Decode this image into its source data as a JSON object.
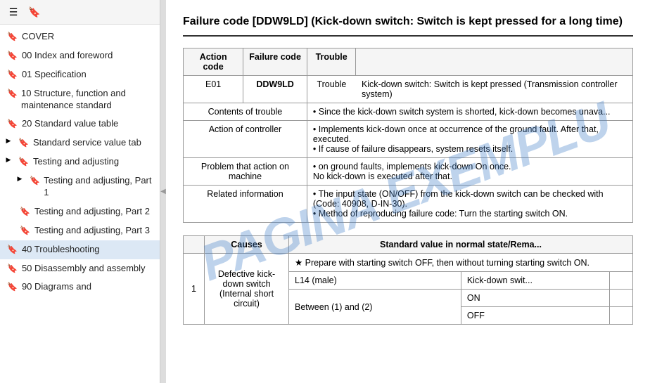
{
  "sidebar": {
    "toolbar": {
      "icon1": "☰",
      "icon2": "🔖"
    },
    "items": [
      {
        "id": "cover",
        "label": "COVER",
        "indent": 0,
        "has_arrow": false
      },
      {
        "id": "00-index",
        "label": "00 Index and foreword",
        "indent": 0,
        "has_arrow": false
      },
      {
        "id": "01-spec",
        "label": "01 Specification",
        "indent": 0,
        "has_arrow": false
      },
      {
        "id": "10-structure",
        "label": "10 Structure, function and maintenance standard",
        "indent": 0,
        "has_arrow": false
      },
      {
        "id": "20-standard",
        "label": "20 Standard value table",
        "indent": 0,
        "has_arrow": false
      },
      {
        "id": "standard-service",
        "label": "Standard service value tab",
        "indent": 0,
        "has_arrow": true,
        "expanded": false
      },
      {
        "id": "testing-adj",
        "label": "Testing and adjusting",
        "indent": 0,
        "has_arrow": true,
        "expanded": false
      },
      {
        "id": "testing-adj-1",
        "label": "Testing and adjusting, Part 1",
        "indent": 1,
        "has_arrow": true,
        "expanded": false
      },
      {
        "id": "testing-adj-2",
        "label": "Testing and adjusting, Part 2",
        "indent": 1,
        "has_arrow": false
      },
      {
        "id": "testing-adj-3",
        "label": "Testing and adjusting, Part 3",
        "indent": 1,
        "has_arrow": false
      },
      {
        "id": "40-troubleshooting",
        "label": "40 Troubleshooting",
        "indent": 0,
        "has_arrow": false
      },
      {
        "id": "50-disassembly",
        "label": "50 Disassembly and assembly",
        "indent": 0,
        "has_arrow": false
      },
      {
        "id": "90-diagrams",
        "label": "90 Diagrams and",
        "indent": 0,
        "has_arrow": false
      }
    ]
  },
  "main": {
    "title": "Failure code [DDW9LD] (Kick-down switch: Switch is kept pressed for a long time)",
    "title_truncated": "Failure code [DDW9LD] (Kick-down switch: Switch is ke... long time)",
    "table": {
      "headers": {
        "action_code": "Action code",
        "failure_code": "Failure code",
        "trouble": "Trouble"
      },
      "row1": {
        "action_code_val": "E01",
        "failure_code_val": "DDW9LD",
        "trouble_desc": "Kick-down switch: Switch is kept pressed (Transmission controller system)"
      },
      "rows": [
        {
          "header": "Contents of trouble",
          "content": "• Since the kick-down switch system is shorted, kick-down becomes unava..."
        },
        {
          "header": "Action of controller",
          "content": "• Implements kick-down once at occurrence of the ground fault. After that,  executed.\n• If cause of failure disappears, system resets itself."
        },
        {
          "header": "Problem that action on machine",
          "content": "•  on ground faults, implements kick-down On once.\nNo kick-down is executed after that."
        },
        {
          "header": "Related information",
          "content": "• The input state (ON/OFF) from the kick-down switch can be checked with (Code: 40908, D-IN-30).\n• Method of reproducing failure code: Turn the starting switch ON."
        }
      ]
    },
    "causes_table": {
      "headers": {
        "causes": "Causes",
        "standard_value": "Standard value in normal state/Rema..."
      },
      "rows": [
        {
          "num": "1",
          "cause": "Defective kick-down switch (Internal short circuit)",
          "sub_rows": [
            {
              "sub_header": "★ Prepare with starting switch OFF, then without turning starting switch ON.",
              "connector": "L14 (male)",
              "item": "Kick-down swit...",
              "between": "Between (1) and (2)",
              "on_val": "ON",
              "off_val": "OFF"
            }
          ]
        }
      ]
    }
  },
  "watermark": "PAGINA EXEMPLU"
}
